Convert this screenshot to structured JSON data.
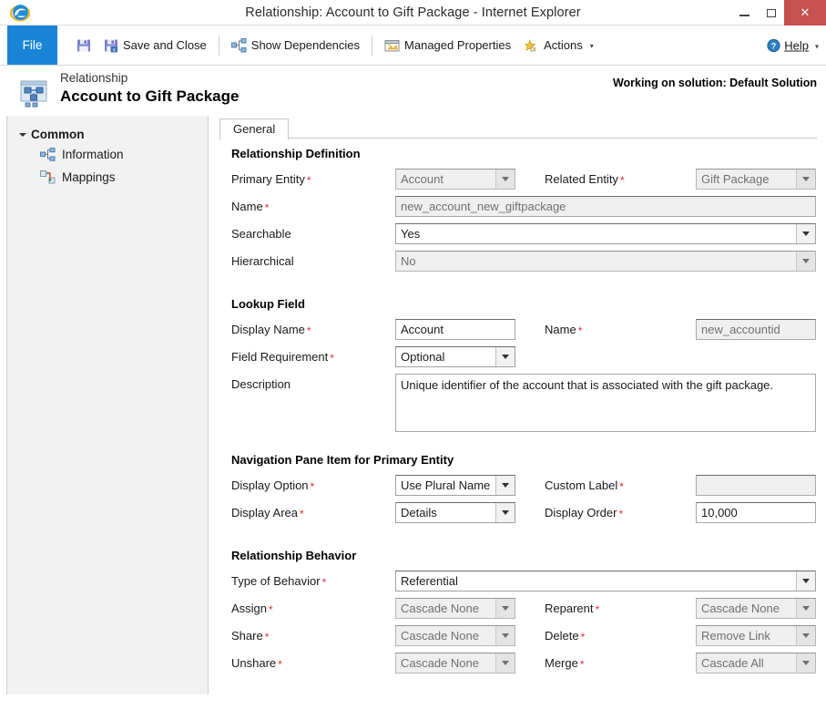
{
  "window": {
    "title": "Relationship: Account to Gift Package - Internet Explorer",
    "app_icon": "internet-explorer-icon",
    "minimize": "–",
    "maximize": "▫",
    "close": "✕"
  },
  "ribbon": {
    "file_tab": "File",
    "buttons": [
      {
        "label": "",
        "icon": "save-icon"
      },
      {
        "label": "Save and Close",
        "icon": "save-and-close-icon"
      },
      {
        "label": "Show Dependencies",
        "icon": "dependencies-icon"
      },
      {
        "label": "Managed Properties",
        "icon": "managed-properties-icon"
      },
      {
        "label": "Actions",
        "icon": "actions-icon",
        "caret": "▾"
      }
    ],
    "help": "Help",
    "help_caret": "▾"
  },
  "header": {
    "entity_type": "Relationship",
    "title": "Account to Gift Package",
    "solution_note": "Working on solution: Default Solution",
    "icon": "relationship-icon"
  },
  "sidebar": {
    "group_label": "Common",
    "items": [
      {
        "label": "Information",
        "icon": "information-icon"
      },
      {
        "label": "Mappings",
        "icon": "mappings-icon"
      }
    ]
  },
  "tabs": [
    {
      "label": "General",
      "active": true
    }
  ],
  "sections": {
    "relationship_definition": {
      "title": "Relationship Definition",
      "primary_entity": {
        "label": "Primary Entity",
        "required": "*",
        "value": "Account",
        "disabled": true
      },
      "related_entity": {
        "label": "Related Entity",
        "required": "*",
        "value": "Gift Package",
        "disabled": true
      },
      "name": {
        "label": "Name",
        "required": "*",
        "value": "new_account_new_giftpackage",
        "disabled": true
      },
      "searchable": {
        "label": "Searchable",
        "required": "",
        "value": "Yes",
        "disabled": false
      },
      "hierarchical": {
        "label": "Hierarchical",
        "required": "",
        "value": "No",
        "disabled": true
      }
    },
    "lookup_field": {
      "title": "Lookup Field",
      "display_name": {
        "label": "Display Name",
        "required": "*",
        "value": "Account",
        "disabled": false
      },
      "name": {
        "label": "Name",
        "required": "*",
        "value": "new_accountid",
        "disabled": true
      },
      "field_requirement": {
        "label": "Field Requirement",
        "required": "*",
        "value": "Optional",
        "disabled": false
      },
      "description": {
        "label": "Description",
        "required": "",
        "value": "Unique identifier of the account that is associated with the gift package.",
        "disabled": false
      }
    },
    "navigation_pane": {
      "title": "Navigation Pane Item for Primary Entity",
      "display_option": {
        "label": "Display Option",
        "required": "*",
        "value": "Use Plural Name",
        "disabled": false
      },
      "custom_label": {
        "label": "Custom Label",
        "required": "*",
        "value": "",
        "disabled": true
      },
      "display_area": {
        "label": "Display Area",
        "required": "*",
        "value": "Details",
        "disabled": false
      },
      "display_order": {
        "label": "Display Order",
        "required": "*",
        "value": "10,000",
        "disabled": false
      }
    },
    "relationship_behavior": {
      "title": "Relationship Behavior",
      "type_of_behavior": {
        "label": "Type of Behavior",
        "required": "*",
        "value": "Referential",
        "disabled": false
      },
      "assign": {
        "label": "Assign",
        "required": "*",
        "value": "Cascade None",
        "disabled": true
      },
      "reparent": {
        "label": "Reparent",
        "required": "*",
        "value": "Cascade None",
        "disabled": true
      },
      "share": {
        "label": "Share",
        "required": "*",
        "value": "Cascade None",
        "disabled": true
      },
      "delete": {
        "label": "Delete",
        "required": "*",
        "value": "Remove Link",
        "disabled": true
      },
      "unshare": {
        "label": "Unshare",
        "required": "*",
        "value": "Cascade None",
        "disabled": true
      },
      "merge": {
        "label": "Merge",
        "required": "*",
        "value": "Cascade All",
        "disabled": true
      }
    }
  },
  "colors": {
    "file_tab_blue": "#1a85d6",
    "close_red": "#c75050",
    "required_red": "#e03030",
    "sidebar_gray": "#f2f2f2",
    "disabled_gray": "#efefef"
  }
}
